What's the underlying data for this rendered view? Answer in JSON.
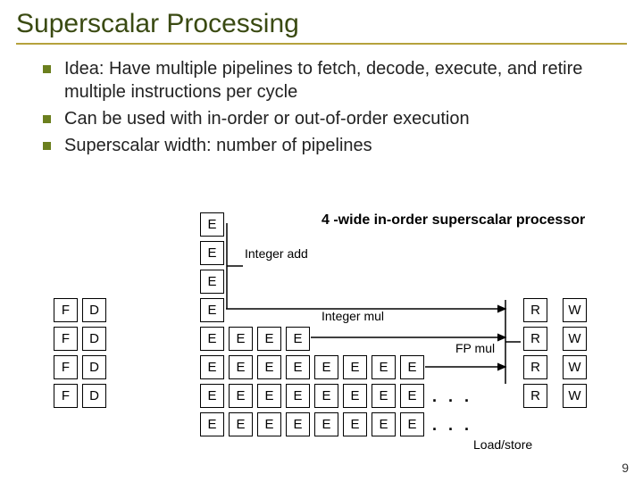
{
  "title": "Superscalar Processing",
  "bullets": [
    "Idea: Have multiple pipelines to fetch, decode, execute, and retire multiple instructions per cycle",
    "Can be used with in-order or out-of-order execution",
    "Superscalar width: number of pipelines"
  ],
  "caption": "4 -wide in-order superscalar processor",
  "stages": {
    "F": "F",
    "D": "D",
    "E": "E",
    "R": "R",
    "W": "W"
  },
  "labels": {
    "int_add": "Integer add",
    "int_mul": "Integer mul",
    "fp_mul": "FP mul",
    "load_store": "Load/store"
  },
  "dots": ". . .",
  "page": "9"
}
